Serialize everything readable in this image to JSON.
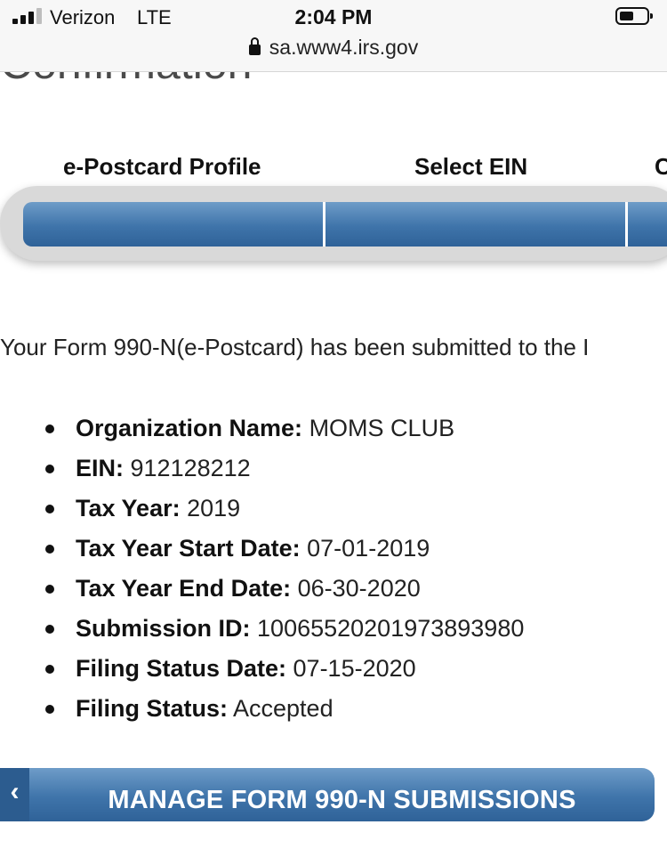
{
  "status_bar": {
    "carrier": "Verizon",
    "network": "LTE",
    "time": "2:04 PM",
    "url": "sa.www4.irs.gov"
  },
  "page": {
    "title": "Confirmation"
  },
  "steps": [
    {
      "label": "e-Postcard Profile"
    },
    {
      "label": "Select EIN"
    },
    {
      "label": "C"
    }
  ],
  "message": "Your Form 990-N(e-Postcard) has been submitted to the I",
  "details": [
    {
      "label": "Organization Name:",
      "value": "MOMS CLUB"
    },
    {
      "label": "EIN:",
      "value": "912128212"
    },
    {
      "label": "Tax Year:",
      "value": "2019"
    },
    {
      "label": "Tax Year Start Date:",
      "value": "07-01-2019"
    },
    {
      "label": "Tax Year End Date:",
      "value": "06-30-2020"
    },
    {
      "label": "Submission ID:",
      "value": "10065520201973893980"
    },
    {
      "label": "Filing Status Date:",
      "value": "07-15-2020"
    },
    {
      "label": "Filing Status:",
      "value": "Accepted"
    }
  ],
  "manage_button": {
    "chevron": "‹",
    "label": "MANAGE FORM 990-N SUBMISSIONS"
  },
  "colors": {
    "accent_blue": "#3f74aa",
    "track_gray": "#d9d9d9"
  }
}
